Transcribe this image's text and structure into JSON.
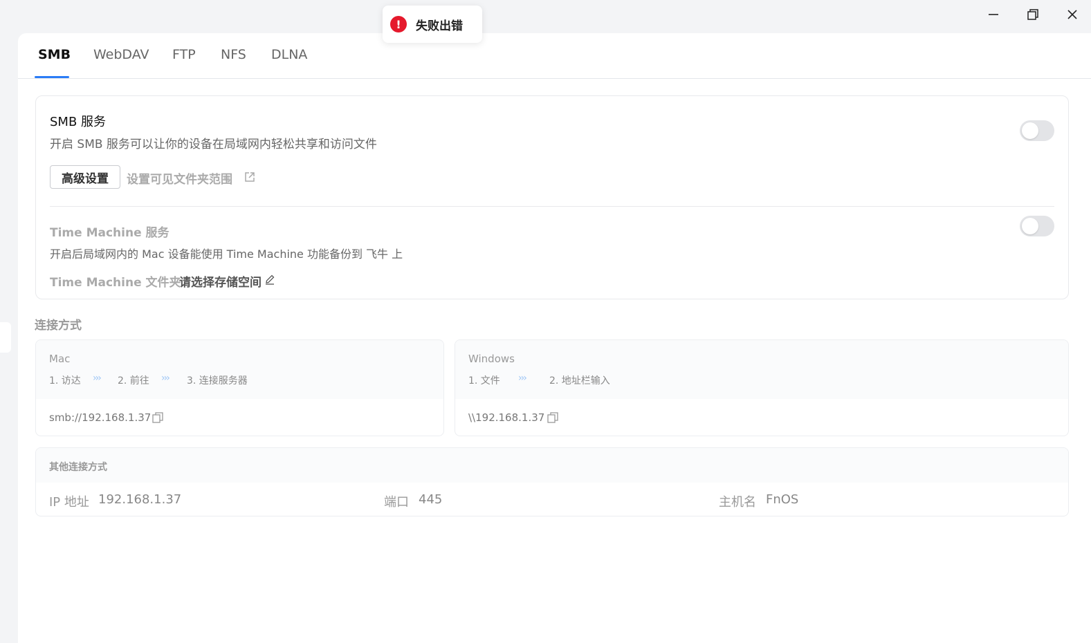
{
  "toast": {
    "message": "失败出错"
  },
  "tabs": [
    {
      "label": "SMB"
    },
    {
      "label": "WebDAV"
    },
    {
      "label": "FTP"
    },
    {
      "label": "NFS"
    },
    {
      "label": "DLNA"
    }
  ],
  "smb": {
    "title": "SMB 服务",
    "description": "开启 SMB 服务可以让你的设备在局域网内轻松共享和访问文件",
    "enabled": false,
    "advanced_button": "高级设置",
    "folder_scope_link": "设置可见文件夹范围"
  },
  "time_machine": {
    "title": "Time Machine 服务",
    "description": "开启后局域网内的 Mac 设备能使用 Time Machine 功能备份到 飞牛 上",
    "enabled": false,
    "folder_label": "Time Machine 文件夹",
    "folder_value": "请选择存储空间"
  },
  "connection": {
    "section_title": "连接方式",
    "mac": {
      "title": "Mac",
      "steps": [
        "1. 访达",
        "2. 前往",
        "3. 连接服务器"
      ],
      "address": "smb://192.168.1.37"
    },
    "windows": {
      "title": "Windows",
      "steps": [
        "1. 文件",
        "2. 地址栏输入"
      ],
      "address": "\\\\192.168.1.37"
    },
    "arrow": "›››",
    "other": {
      "title": "其他连接方式",
      "ip_label": "IP 地址",
      "ip_value": "192.168.1.37",
      "port_label": "端口",
      "port_value": "445",
      "host_label": "主机名",
      "host_value": "FnOS"
    }
  },
  "colors": {
    "accent": "#2a7cf6",
    "error": "#e5192c",
    "arrow": "#9cc5f5"
  }
}
